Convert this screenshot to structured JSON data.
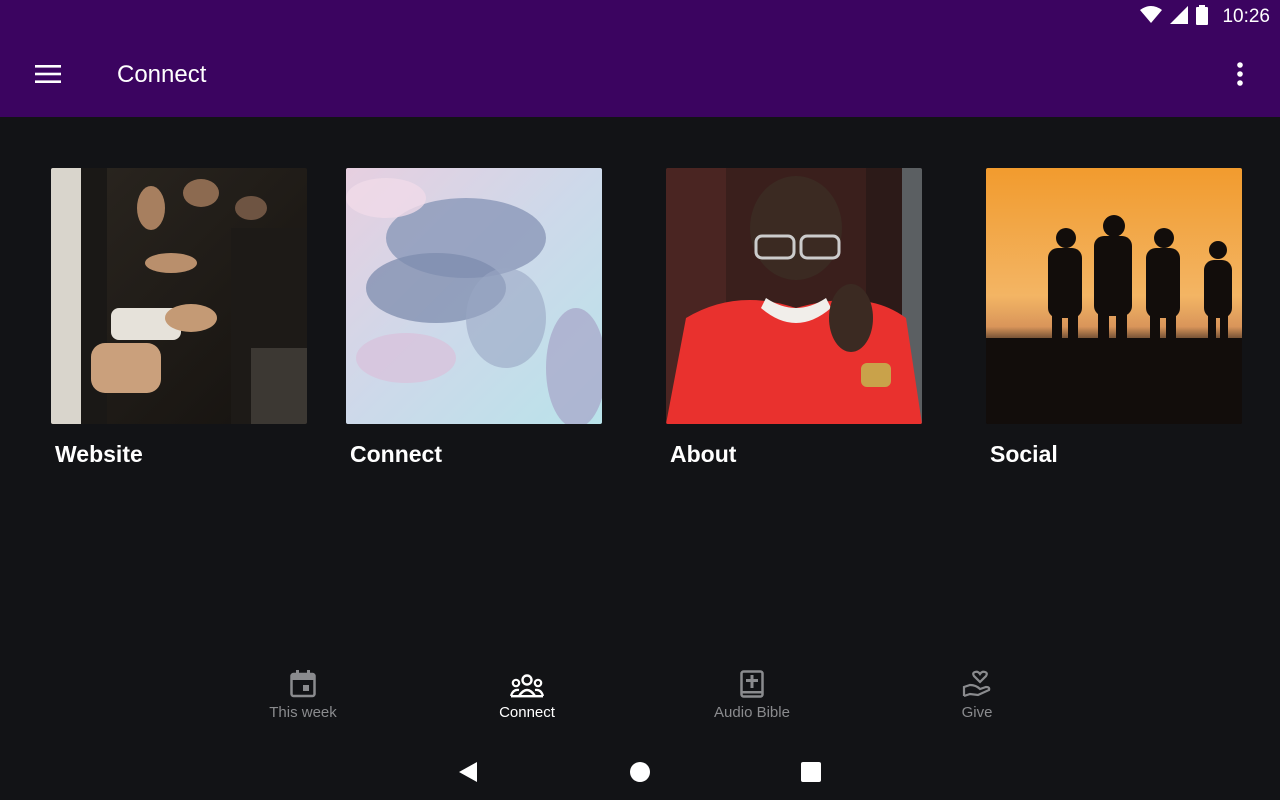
{
  "status": {
    "time": "10:26"
  },
  "appbar": {
    "title": "Connect"
  },
  "tiles": [
    {
      "label": "Website"
    },
    {
      "label": "Connect"
    },
    {
      "label": "About"
    },
    {
      "label": "Social"
    }
  ],
  "bottom_nav": {
    "items": [
      {
        "label": "This week",
        "icon": "calendar-icon"
      },
      {
        "label": "Connect",
        "icon": "group-icon",
        "active": true
      },
      {
        "label": "Audio Bible",
        "icon": "bible-icon"
      },
      {
        "label": "Give",
        "icon": "give-heart-icon"
      }
    ]
  },
  "colors": {
    "appbar": "#3b0460",
    "background": "#121316",
    "nav_active": "#ffffff",
    "nav_inactive": "#8a8b8e"
  }
}
